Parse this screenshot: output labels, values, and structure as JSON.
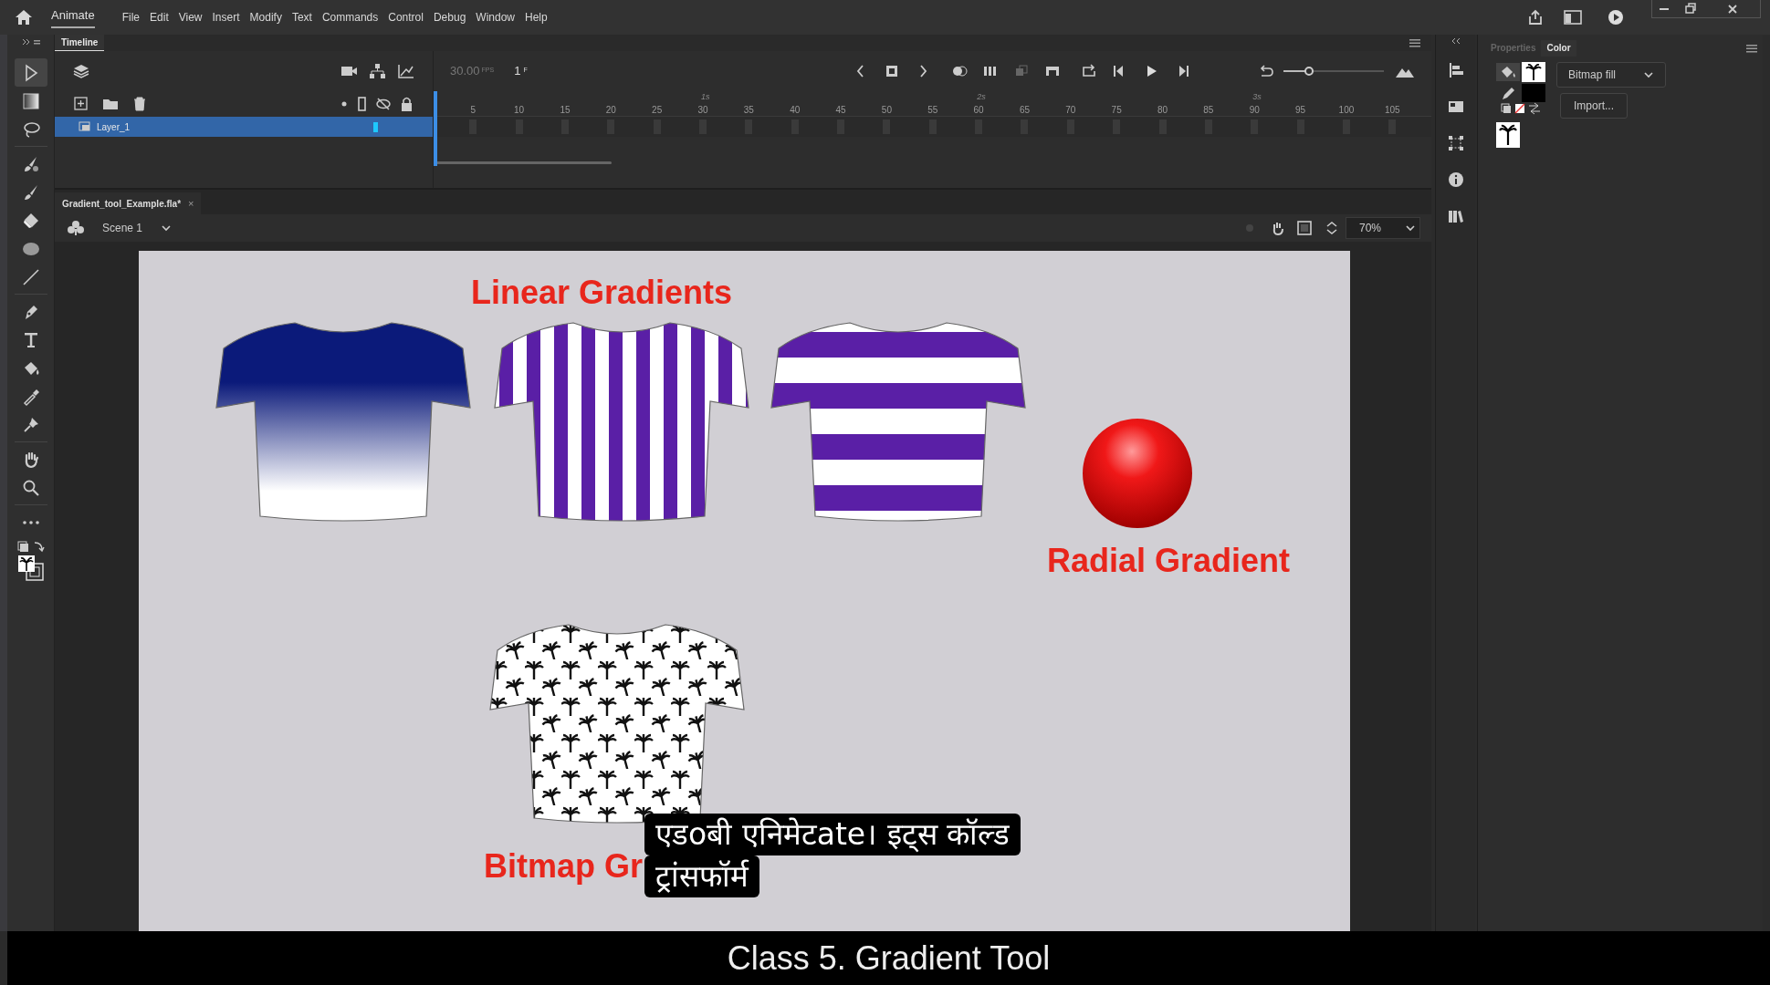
{
  "app": {
    "name": "Animate",
    "menu": [
      "File",
      "Edit",
      "View",
      "Insert",
      "Modify",
      "Text",
      "Commands",
      "Control",
      "Debug",
      "Window",
      "Help"
    ]
  },
  "tools": [
    {
      "kind": "select",
      "selected": true
    },
    {
      "kind": "gradient",
      "selected": false
    },
    {
      "kind": "lasso",
      "selected": false
    },
    {
      "kind": "paint-brush",
      "selected": false
    },
    {
      "kind": "brush",
      "selected": false
    },
    {
      "kind": "eraser",
      "selected": false
    },
    {
      "kind": "ellipse",
      "selected": false
    },
    {
      "kind": "line",
      "selected": false
    },
    {
      "kind": "pen",
      "selected": false
    },
    {
      "kind": "text",
      "selected": false
    },
    {
      "kind": "bucket",
      "selected": false
    },
    {
      "kind": "eyedropper",
      "selected": false
    },
    {
      "kind": "pin",
      "selected": false
    },
    {
      "kind": "hand",
      "selected": false
    },
    {
      "kind": "zoom",
      "selected": false
    },
    {
      "kind": "more",
      "selected": false
    }
  ],
  "timeline": {
    "tab": "Timeline",
    "fps": "30.00",
    "fps_unit": "FPS",
    "frame": "1",
    "frame_unit": "F",
    "layers": [
      {
        "name": "Layer_1",
        "selected": true
      }
    ],
    "seconds": [
      "1s",
      "2s",
      "3s"
    ],
    "zoom_slider": {
      "level": 0.25
    },
    "frame_numbers": [
      "5",
      "10",
      "15",
      "20",
      "25",
      "30",
      "35",
      "40",
      "45",
      "50",
      "55",
      "60",
      "65",
      "70",
      "75",
      "80",
      "85",
      "90",
      "95",
      "100",
      "105"
    ]
  },
  "document": {
    "tab": "Gradient_tool_Example.fla*",
    "close": "×",
    "scene": "Scene 1",
    "zoom": "70%"
  },
  "stage": {
    "linear_title": "Linear Gradients",
    "radial_title": "Radial Gradient",
    "bitmap_title": "Bitmap Gr",
    "shirts": [
      {
        "kind": "gradient"
      },
      {
        "kind": "vertical-stripes"
      },
      {
        "kind": "horizontal-stripes"
      },
      {
        "kind": "bitmap"
      }
    ]
  },
  "right_panel": {
    "tabs": [
      {
        "label": "Properties",
        "selected": false
      },
      {
        "label": "Color",
        "selected": true
      }
    ],
    "fill_type": "Bitmap fill",
    "import_button": "Import..."
  },
  "subtitle_lines": [
    "एडoबी एनिमेटate। इट्स कॉल्ड",
    "ट्रांसफॉर्म"
  ],
  "caption": "Class 5. Gradient Tool"
}
